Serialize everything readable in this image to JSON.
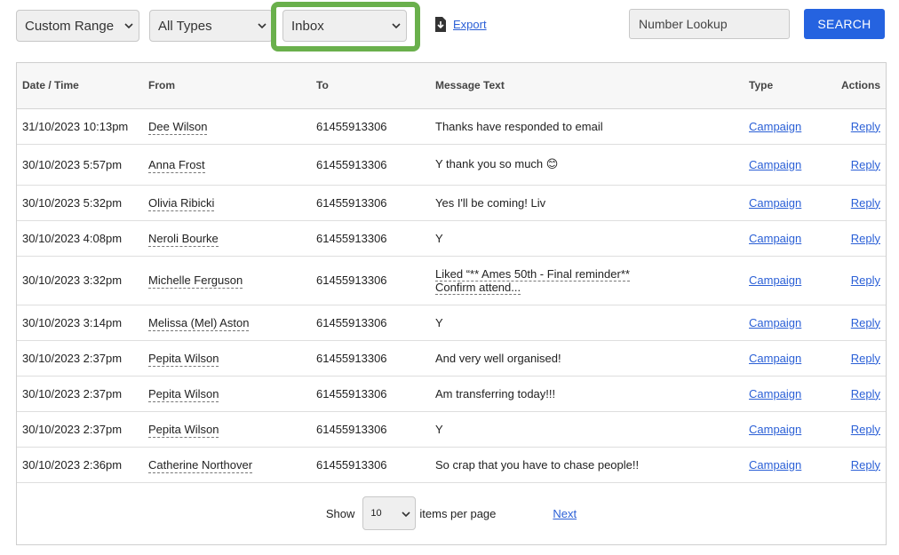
{
  "filters": {
    "range": "Custom Range",
    "types": "All Types",
    "folder": "Inbox"
  },
  "export_label": "Export",
  "lookup_placeholder": "Number Lookup",
  "search_label": "SEARCH",
  "table": {
    "headers": [
      "Date / Time",
      "From",
      "To",
      "Message Text",
      "Type",
      "Actions"
    ],
    "rows": [
      {
        "datetime": "31/10/2023 10:13pm",
        "from": "Dee Wilson",
        "to": "61455913306",
        "message": "Thanks have responded to email",
        "type": "Campaign",
        "action": "Reply"
      },
      {
        "datetime": "30/10/2023 5:57pm",
        "from": "Anna Frost",
        "to": "61455913306",
        "message": "Y thank you so much 😊",
        "type": "Campaign",
        "action": "Reply"
      },
      {
        "datetime": "30/10/2023 5:32pm",
        "from": "Olivia Ribicki",
        "to": "61455913306",
        "message": "Yes I'll be coming! Liv",
        "type": "Campaign",
        "action": "Reply"
      },
      {
        "datetime": "30/10/2023 4:08pm",
        "from": "Neroli Bourke",
        "to": "61455913306",
        "message": "Y",
        "type": "Campaign",
        "action": "Reply"
      },
      {
        "datetime": "30/10/2023 3:32pm",
        "from": "Michelle Ferguson",
        "to": "61455913306",
        "message_line1": "Liked “** Ames 50th - Final reminder**",
        "message_line2": "Confirm attend...",
        "type": "Campaign",
        "action": "Reply"
      },
      {
        "datetime": "30/10/2023 3:14pm",
        "from": "Melissa (Mel) Aston",
        "to": "61455913306",
        "message": "Y",
        "type": "Campaign",
        "action": "Reply"
      },
      {
        "datetime": "30/10/2023 2:37pm",
        "from": "Pepita Wilson",
        "to": "61455913306",
        "message": "And very well organised!",
        "type": "Campaign",
        "action": "Reply"
      },
      {
        "datetime": "30/10/2023 2:37pm",
        "from": "Pepita Wilson",
        "to": "61455913306",
        "message": "Am transferring today!!!",
        "type": "Campaign",
        "action": "Reply"
      },
      {
        "datetime": "30/10/2023 2:37pm",
        "from": "Pepita Wilson",
        "to": "61455913306",
        "message": "Y",
        "type": "Campaign",
        "action": "Reply"
      },
      {
        "datetime": "30/10/2023 2:36pm",
        "from": "Catherine Northover",
        "to": "61455913306",
        "message": "So crap that you have to chase people!!",
        "type": "Campaign",
        "action": "Reply"
      }
    ]
  },
  "pager": {
    "show_label": "Show",
    "per_page_value": "10",
    "items_label": "items per page",
    "next_label": "Next"
  },
  "colors": {
    "accent": "#2563e0",
    "highlight": "#6ab04c",
    "link": "#2a5fd6"
  }
}
